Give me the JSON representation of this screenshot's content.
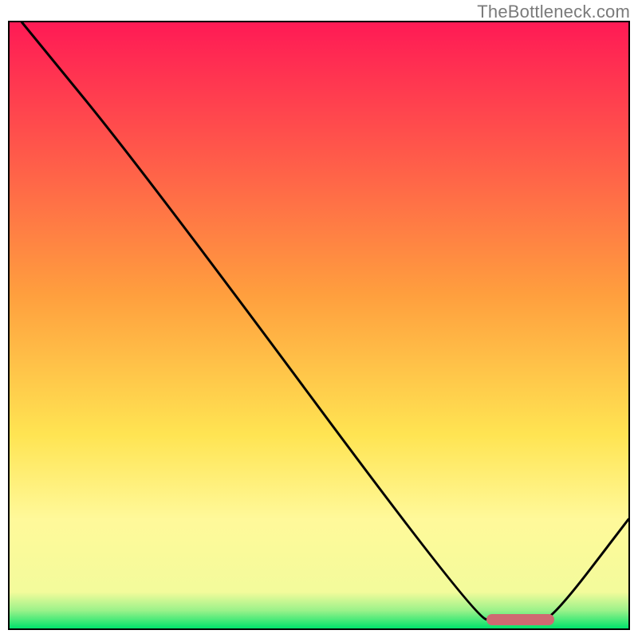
{
  "watermark": "TheBottleneck.com",
  "chart_data": {
    "type": "line",
    "title": "",
    "xlabel": "",
    "ylabel": "",
    "xlim": [
      0,
      100
    ],
    "ylim": [
      0,
      100
    ],
    "gradient_stops": [
      {
        "pos": 0.0,
        "color": "#00e26b"
      },
      {
        "pos": 0.03,
        "color": "#9cf28a"
      },
      {
        "pos": 0.06,
        "color": "#f3fb9b"
      },
      {
        "pos": 0.18,
        "color": "#fff99a"
      },
      {
        "pos": 0.32,
        "color": "#ffe452"
      },
      {
        "pos": 0.55,
        "color": "#ff9f3e"
      },
      {
        "pos": 0.78,
        "color": "#ff5a4a"
      },
      {
        "pos": 1.0,
        "color": "#ff1a55"
      }
    ],
    "series": [
      {
        "name": "curve",
        "points": [
          {
            "x": 2,
            "y": 100
          },
          {
            "x": 22,
            "y": 75
          },
          {
            "x": 75,
            "y": 2
          },
          {
            "x": 79,
            "y": 1
          },
          {
            "x": 85,
            "y": 1
          },
          {
            "x": 88,
            "y": 2
          },
          {
            "x": 100,
            "y": 18
          }
        ]
      }
    ],
    "marker": {
      "x_start": 77,
      "x_end": 88,
      "y": 1.5
    }
  }
}
